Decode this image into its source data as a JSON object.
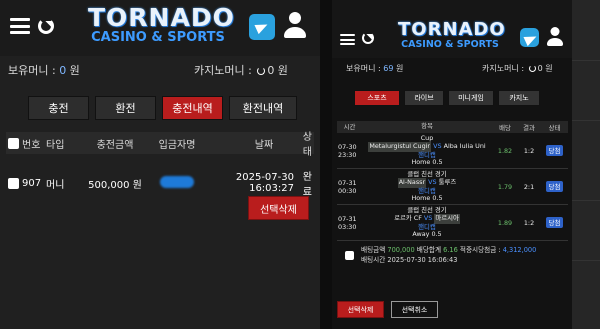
{
  "brand": {
    "name": "TORNADO",
    "tagline": "CASINO & SPORTS"
  },
  "left": {
    "balance_label": "보유머니 : ",
    "balance_value": "0",
    "balance_unit": " 원",
    "casino_label": "카지노머니 : ",
    "casino_value": "0",
    "casino_unit": " 원",
    "tabs": [
      "충전",
      "환전",
      "충전내역",
      "환전내역"
    ],
    "active_tab": 2,
    "columns": [
      "번호",
      "타입",
      "충전금액",
      "입금자명",
      "날짜",
      "상태"
    ],
    "rows": [
      {
        "no": "907",
        "type": "머니",
        "amount": "500,000 원",
        "date": "2025-07-30 16:03:27",
        "status": "완료"
      }
    ],
    "delete_button": "선택삭제"
  },
  "right": {
    "balance_label": "보유머니 : ",
    "balance_value": "69",
    "balance_unit": " 원",
    "casino_label": "카지노머니 : ",
    "casino_value": "0",
    "casino_unit": " 원",
    "tabs": [
      "스포츠",
      "라이브",
      "미니게임",
      "카지노"
    ],
    "active_tab": 0,
    "columns": [
      "시간",
      "항목",
      "배당",
      "결과",
      "상태"
    ],
    "bets": [
      {
        "date": "07-30",
        "time": "23:30",
        "league": "Cup",
        "home": "Metalurgistul Cugir",
        "vs": "VS",
        "away": "Alba Iulia Uni",
        "market": "핸디캡",
        "pick": "Home 0.5",
        "odds": "1.82",
        "result": "1:2",
        "status": "당첨"
      },
      {
        "date": "07-31",
        "time": "00:30",
        "league": "클럽 친선 경기",
        "home": "Al-Nassr",
        "vs": "VS",
        "away": "툴루즈",
        "market": "핸디캡",
        "pick": "Home 0.5",
        "odds": "1.79",
        "result": "2:1",
        "status": "당첨"
      },
      {
        "date": "07-31",
        "time": "03:30",
        "league": "클럽 친선 경기",
        "home": "로르카 CF",
        "vs": "VS",
        "away": "마르시아",
        "market": "핸디캡",
        "pick": "Away 0.5",
        "odds": "1.89",
        "result": "1:2",
        "status": "당첨"
      }
    ],
    "summary": {
      "bet_label": "배팅금액 ",
      "bet_value": "700,000",
      "odds_label": " 배당합계 ",
      "odds_value": "6.16",
      "win_label": " 적중시당첨금 : ",
      "win_value": "4,312,000",
      "time_label": "배팅시간 ",
      "time_value": "2025-07-30 16:06:43"
    },
    "delete_button": "선택삭제",
    "cancel_button": "선택취소"
  },
  "colors": {
    "accent_red": "#b91d1d",
    "accent_blue": "#3d9bff",
    "odds_green": "#6dc26d",
    "badge_blue": "#2e62c9"
  }
}
